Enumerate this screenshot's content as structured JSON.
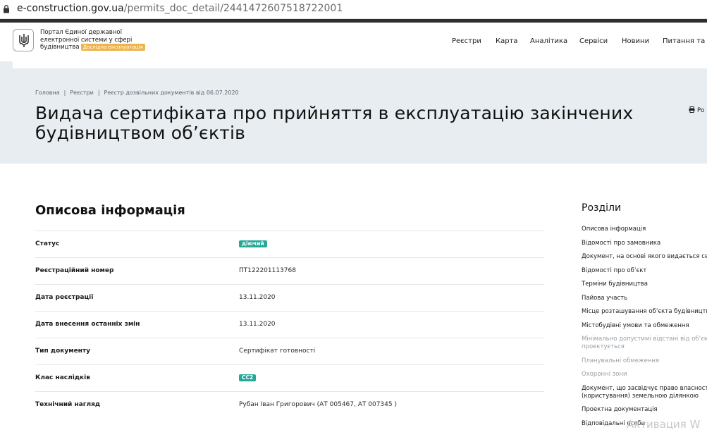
{
  "browser": {
    "url_host": "e-construction.gov.ua",
    "url_path": "/permits_doc_detail/2441472607518722001"
  },
  "header": {
    "logo_line1": "Портал Єдиної державної",
    "logo_line2": "електронної системи у сфері",
    "logo_line3": "будівництва",
    "beta_label": "Дослідна експлуатація",
    "nav": [
      "Реєстри",
      "Карта",
      "Аналітика",
      "Сервіси",
      "Новини",
      "Питання та в"
    ]
  },
  "breadcrumbs": [
    "Головна",
    "Реєстри",
    "Реєстр дозвільних документів від 06.07.2020"
  ],
  "page_title": "Видача сертифіката про прийняття в експлуатацію закінчених будівництвом об’єктів",
  "print_label": "Ро",
  "section_title": "Описова інформація",
  "fields": [
    {
      "label": "Статус",
      "value": "діючий",
      "badge": true
    },
    {
      "label": "Реєстраційний номер",
      "value": "ПТ122201113768",
      "badge": false
    },
    {
      "label": "Дата реєстрації",
      "value": "13.11.2020",
      "badge": false
    },
    {
      "label": "Дата внесення останніх змін",
      "value": "13.11.2020",
      "badge": false
    },
    {
      "label": "Тип документу",
      "value": "Сертифікат готовності",
      "badge": false
    },
    {
      "label": "Клас наслідків",
      "value": "CC2",
      "badge": true
    },
    {
      "label": "Технічний нагляд",
      "value": "Рубан Іван Григорович (АТ 005467, АТ 007345 )",
      "badge": false
    }
  ],
  "sidebar": {
    "title": "Розділи",
    "items": [
      {
        "label": "Описова інформація",
        "muted": false
      },
      {
        "label": "Відомості про замовника",
        "muted": false
      },
      {
        "label": "Документ, на основі якого видається се",
        "muted": false
      },
      {
        "label": "Відомості про об’єкт",
        "muted": false
      },
      {
        "label": "Терміни будівництва",
        "muted": false
      },
      {
        "label": "Пайова участь",
        "muted": false
      },
      {
        "label": "Місце розташування об’єкта будівництв",
        "muted": false
      },
      {
        "label": "Містобудівні умови та обмеження",
        "muted": false
      },
      {
        "label": "Мінімально допустимі відстані від об’єк",
        "muted": true
      },
      {
        "label": "проектується",
        "muted": true
      },
      {
        "label": "Планувальні обмеження",
        "muted": true
      },
      {
        "label": "Охоронні зони",
        "muted": true
      },
      {
        "label": "Документ, що засвідчує право власност",
        "muted": false
      },
      {
        "label": "(користування) земельною ділянкою",
        "muted": false
      },
      {
        "label": "Проектна документація",
        "muted": false
      },
      {
        "label": "Відповідальні особи",
        "muted": false
      }
    ]
  },
  "watermark": "Активация W",
  "colors": {
    "badge": "#27a896",
    "hero_bg": "#e7edf1",
    "beta": "#f0b34a"
  }
}
